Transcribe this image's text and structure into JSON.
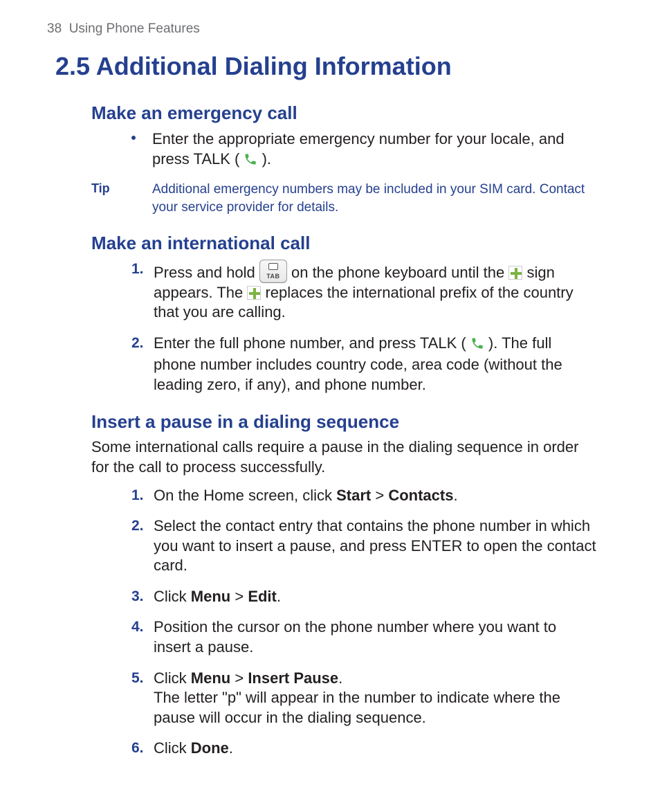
{
  "page_number": "38",
  "chapter": "Using Phone Features",
  "title": "2.5 Additional Dialing Information",
  "sec1": {
    "heading": "Make an emergency call",
    "bullet_a": "Enter the appropriate emergency number for your locale, and press TALK ( ",
    "bullet_b": " ).",
    "tip_label": "Tip",
    "tip_text": "Additional emergency numbers may be included in your SIM card. Contact your service provider for details."
  },
  "sec2": {
    "heading": "Make an international call",
    "s1_a": "Press and hold ",
    "s1_b": " on the phone keyboard until the ",
    "s1_c": " sign appears. The ",
    "s1_d": " replaces the international prefix of the country that you are calling.",
    "s2_a": "Enter the full phone number, and press TALK ( ",
    "s2_b": " ). The full phone number includes country code, area code (without the leading zero, if any), and phone number."
  },
  "sec3": {
    "heading": "Insert a pause in a dialing sequence",
    "intro": "Some international calls require a pause in the dialing sequence in order for the call to process successfully.",
    "s1_a": "On the Home screen, click ",
    "s1_b": "Start",
    "s1_c": " > ",
    "s1_d": "Contacts",
    "s1_e": ".",
    "s2": "Select the contact entry that contains the phone number in which you want to insert a pause, and press ENTER to open the contact card.",
    "s3_a": "Click ",
    "s3_b": "Menu",
    "s3_c": " > ",
    "s3_d": "Edit",
    "s3_e": ".",
    "s4": "Position the cursor on the phone number where you want to insert a pause.",
    "s5_a": "Click ",
    "s5_b": "Menu",
    "s5_c": " > ",
    "s5_d": "Insert Pause",
    "s5_e": ".",
    "s5_f": "The letter \"p\" will appear in the number to indicate where the pause will occur in the dialing sequence.",
    "s6_a": "Click ",
    "s6_b": "Done",
    "s6_c": "."
  },
  "nums": {
    "n1": "1.",
    "n2": "2.",
    "n3": "3.",
    "n4": "4.",
    "n5": "5.",
    "n6": "6."
  }
}
